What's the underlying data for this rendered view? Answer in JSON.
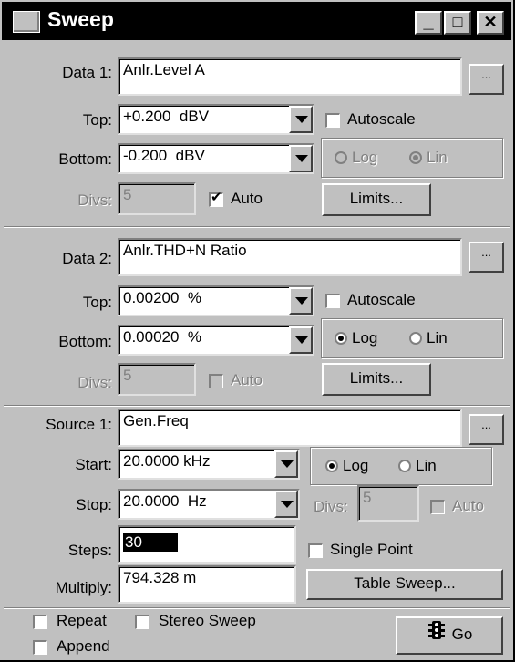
{
  "window": {
    "title": "Sweep"
  },
  "titlebar_buttons": {
    "minimize": "_",
    "maximize": "□",
    "close": "✕"
  },
  "data1": {
    "label": "Data 1:",
    "value": "Anlr.Level A",
    "browse": "...",
    "top_label": "Top:",
    "top_value": "+0.200  dBV",
    "bottom_label": "Bottom:",
    "bottom_value": "-0.200  dBV",
    "autoscale": "Autoscale",
    "log": "Log",
    "lin": "Lin",
    "divs_label": "Divs:",
    "divs_value": "5",
    "auto": "Auto",
    "limits": "Limits..."
  },
  "data2": {
    "label": "Data 2:",
    "value": "Anlr.THD+N Ratio",
    "browse": "...",
    "top_label": "Top:",
    "top_value": "0.00200  %",
    "bottom_label": "Bottom:",
    "bottom_value": "0.00020  %",
    "autoscale": "Autoscale",
    "log": "Log",
    "lin": "Lin",
    "divs_label": "Divs:",
    "divs_value": "5",
    "auto": "Auto",
    "limits": "Limits..."
  },
  "source1": {
    "label": "Source 1:",
    "value": "Gen.Freq",
    "browse": "...",
    "start_label": "Start:",
    "start_value": "20.0000 kHz",
    "stop_label": "Stop:",
    "stop_value": "20.0000  Hz",
    "log": "Log",
    "lin": "Lin",
    "divs_label": "Divs:",
    "divs_value": "5",
    "auto": "Auto",
    "steps_label": "Steps:",
    "steps_value": "30",
    "single_point": "Single Point",
    "multiply_label": "Multiply:",
    "multiply_value": "794.328 m",
    "table_sweep": "Table Sweep..."
  },
  "footer": {
    "repeat": "Repeat",
    "stereo_sweep": "Stereo Sweep",
    "append": "Append",
    "go": "Go"
  }
}
